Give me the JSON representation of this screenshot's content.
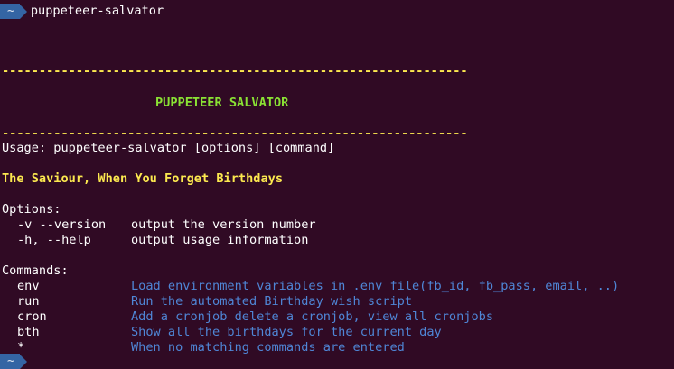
{
  "prompt": {
    "dir": "~",
    "command": "puppeteer-salvator"
  },
  "banner": {
    "rule": "---------------------------------------------------------------",
    "title": "PUPPETEER SALVATOR"
  },
  "usage": "Usage: puppeteer-salvator [options] [command]",
  "tagline": "The Saviour, When You Forget Birthdays",
  "options": {
    "header": "Options:",
    "items": [
      {
        "flag": "-v --version",
        "desc": "output the version number"
      },
      {
        "flag": "-h, --help",
        "desc": "output usage information"
      }
    ]
  },
  "commands": {
    "header": "Commands:",
    "items": [
      {
        "name": "env",
        "desc": "Load environment variables in .env file(fb_id, fb_pass, email, ..)"
      },
      {
        "name": "run",
        "desc": "Run the automated Birthday wish script"
      },
      {
        "name": "cron",
        "desc": "Add a cronjob delete a cronjob, view all cronjobs"
      },
      {
        "name": "bth",
        "desc": "Show all the birthdays for the current day"
      },
      {
        "name": "*",
        "desc": "When no matching commands are entered"
      }
    ]
  },
  "colors": {
    "background": "#300a24",
    "prompt_segment": "#3465a4",
    "rule": "#fce94f",
    "title": "#8ae234",
    "description": "#4f86d6"
  }
}
